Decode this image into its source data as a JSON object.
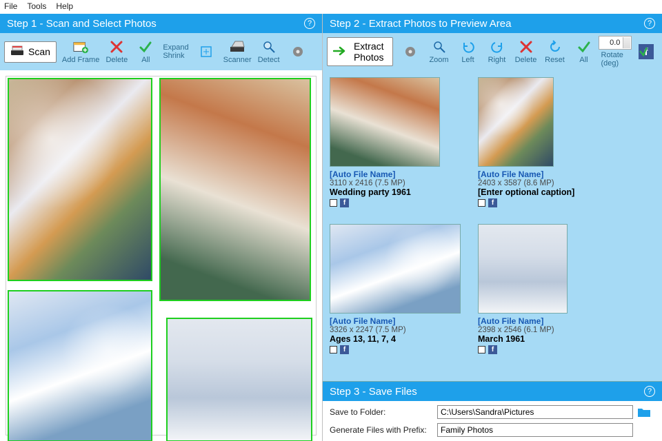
{
  "menu": {
    "file": "File",
    "tools": "Tools",
    "help": "Help"
  },
  "step1": {
    "title": "Step 1 - Scan and Select Photos",
    "scan_btn": "Scan",
    "tb": {
      "addframe": "Add Frame",
      "delete": "Delete",
      "all": "All",
      "expand": "Expand",
      "shrink": "Shrink",
      "scanner": "Scanner",
      "detect": "Detect",
      "settings": "Settings"
    }
  },
  "step2": {
    "title": "Step 2 - Extract Photos to Preview Area",
    "extract_btn": "Extract Photos",
    "tb": {
      "settings": "Settings",
      "zoom": "Zoom",
      "left": "Left",
      "right": "Right",
      "delete": "Delete",
      "reset": "Reset",
      "all": "All",
      "rotate_label": "Rotate (deg)",
      "rotate_value": "0.0",
      "fb": "f"
    },
    "cards": [
      {
        "auto": "[Auto File Name]",
        "dims": "3110 x 2416 (7.5 MP)",
        "caption": "Wedding party 1961"
      },
      {
        "auto": "[Auto File Name]",
        "dims": "2403 x 3587 (8.6 MP)",
        "caption": "[Enter optional caption]"
      },
      {
        "auto": "[Auto File Name]",
        "dims": "3326 x 2247 (7.5 MP)",
        "caption": "Ages 13, 11, 7, 4"
      },
      {
        "auto": "[Auto File Name]",
        "dims": "2398 x 2546 (6.1 MP)",
        "caption": "March 1961"
      }
    ]
  },
  "step3": {
    "title": "Step 3 - Save Files",
    "save_to_label": "Save to Folder:",
    "save_to_value": "C:\\Users\\Sandra\\Pictures",
    "prefix_label": "Generate Files with Prefix:",
    "prefix_value": "Family Photos"
  },
  "icons": {
    "help": "?",
    "gear": "gear",
    "arrow_right_green": "→",
    "folder": "folder"
  }
}
